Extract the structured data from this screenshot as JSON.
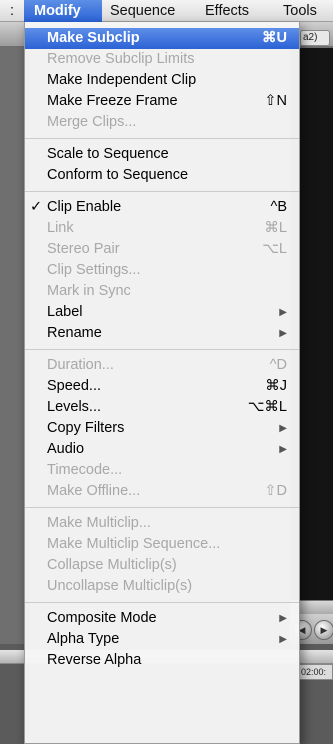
{
  "menubar": {
    "edge_label": ":",
    "items": [
      "Modify",
      "Sequence",
      "Effects",
      "Tools"
    ]
  },
  "background": {
    "tab_label": "a2)",
    "timecode": "02:00:"
  },
  "menu": {
    "groups": [
      [
        {
          "label": "Make Subclip",
          "shortcut": "⌘U",
          "enabled": true,
          "highlighted": true
        },
        {
          "label": "Remove Subclip Limits",
          "enabled": false
        },
        {
          "label": "Make Independent Clip",
          "enabled": true
        },
        {
          "label": "Make Freeze Frame",
          "shortcut": "⇧N",
          "enabled": true
        },
        {
          "label": "Merge Clips...",
          "enabled": false
        }
      ],
      [
        {
          "label": "Scale to Sequence",
          "enabled": true
        },
        {
          "label": "Conform to Sequence",
          "enabled": true
        }
      ],
      [
        {
          "label": "Clip Enable",
          "shortcut": "^B",
          "enabled": true,
          "checked": true
        },
        {
          "label": "Link",
          "shortcut": "⌘L",
          "enabled": false
        },
        {
          "label": "Stereo Pair",
          "shortcut": "⌥L",
          "enabled": false
        },
        {
          "label": "Clip Settings...",
          "enabled": false
        },
        {
          "label": "Mark in Sync",
          "enabled": false
        },
        {
          "label": "Label",
          "enabled": true,
          "submenu": true
        },
        {
          "label": "Rename",
          "enabled": true,
          "submenu": true
        }
      ],
      [
        {
          "label": "Duration...",
          "shortcut": "^D",
          "enabled": false
        },
        {
          "label": "Speed...",
          "shortcut": "⌘J",
          "enabled": true
        },
        {
          "label": "Levels...",
          "shortcut": "⌥⌘L",
          "enabled": true
        },
        {
          "label": "Copy Filters",
          "enabled": true,
          "submenu": true
        },
        {
          "label": "Audio",
          "enabled": true,
          "submenu": true
        },
        {
          "label": "Timecode...",
          "enabled": false
        },
        {
          "label": "Make Offline...",
          "shortcut": "⇧D",
          "enabled": false
        }
      ],
      [
        {
          "label": "Make Multiclip...",
          "enabled": false
        },
        {
          "label": "Make Multiclip Sequence...",
          "enabled": false
        },
        {
          "label": "Collapse Multiclip(s)",
          "enabled": false
        },
        {
          "label": "Uncollapse Multiclip(s)",
          "enabled": false
        }
      ],
      [
        {
          "label": "Composite Mode",
          "enabled": true,
          "submenu": true
        },
        {
          "label": "Alpha Type",
          "enabled": true,
          "submenu": true
        },
        {
          "label": "Reverse Alpha",
          "enabled": true
        }
      ]
    ],
    "checkmark": "✓",
    "submenu_arrow": "▶"
  },
  "colors": {
    "highlight": "#2c62d5",
    "disabled_text": "#a8a8a8"
  }
}
